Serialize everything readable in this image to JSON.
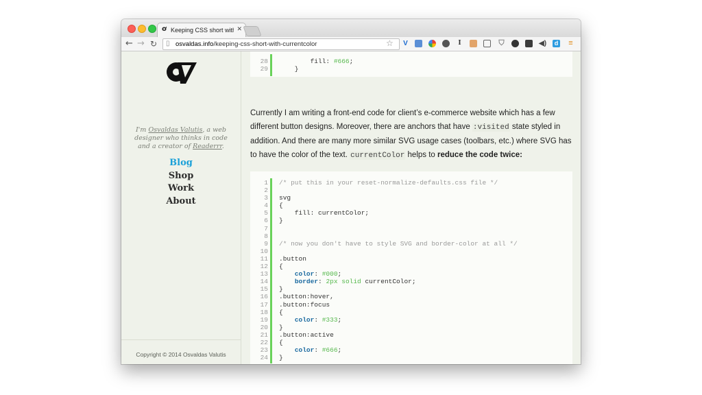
{
  "browser": {
    "tab_title": "Keeping CSS short with cu",
    "tab_favicon": "ov-logo-icon",
    "url_host": "osvaldas.info",
    "url_path": "/keeping-css-short-with-currentcolor",
    "icons": [
      "back-icon",
      "forward-icon",
      "reload-icon",
      "page-icon",
      "star-icon",
      "menu-icon"
    ]
  },
  "sidebar": {
    "bio_prefix": "I'm ",
    "bio_name": "Osvaldas Valutis",
    "bio_middle": ", a web designer who thinks in code and a creator of ",
    "bio_product": "Readerrr",
    "bio_suffix": ".",
    "nav": [
      {
        "label": "Blog",
        "active": true
      },
      {
        "label": "Shop",
        "active": false
      },
      {
        "label": "Work",
        "active": false
      },
      {
        "label": "About",
        "active": false
      }
    ],
    "copyright": "Copyright © 2014 Osvaldas Valutis",
    "accent_color": "#1aa0d8"
  },
  "code_top": {
    "lines": [
      {
        "num": "28",
        "text": "        fill: ",
        "val": "#666",
        "tail": ";"
      },
      {
        "num": "29",
        "text": "    }",
        "val": "",
        "tail": ""
      }
    ]
  },
  "prose": {
    "p1": "Currently I am writing a front-end code for client’s e-commerce website which has a few different button designs. Moreover, there are anchors that have ",
    "code1": ":visited",
    "p2": " state styled in addition. And there are many more similar SVG usage cases (toolbars, etc.) where SVG has to have the color of the text. ",
    "code2": "currentColor",
    "p3": " helps to ",
    "bold": "reduce the code twice:"
  },
  "code_main": {
    "lines": [
      {
        "num": "1",
        "parts": [
          {
            "t": "comment",
            "s": "/* put this in your reset-normalize-defaults.css file */"
          }
        ]
      },
      {
        "num": "2",
        "parts": []
      },
      {
        "num": "3",
        "parts": [
          {
            "t": "plain",
            "s": "svg"
          }
        ]
      },
      {
        "num": "4",
        "parts": [
          {
            "t": "plain",
            "s": "{"
          }
        ]
      },
      {
        "num": "5",
        "parts": [
          {
            "t": "plain",
            "s": "    fill: currentColor;"
          }
        ]
      },
      {
        "num": "6",
        "parts": [
          {
            "t": "plain",
            "s": "}"
          }
        ]
      },
      {
        "num": "7",
        "parts": []
      },
      {
        "num": "8",
        "parts": []
      },
      {
        "num": "9",
        "parts": [
          {
            "t": "comment",
            "s": "/* now you don't have to style SVG and border-color at all */"
          }
        ]
      },
      {
        "num": "10",
        "parts": []
      },
      {
        "num": "11",
        "parts": [
          {
            "t": "plain",
            "s": ".button"
          }
        ]
      },
      {
        "num": "12",
        "parts": [
          {
            "t": "plain",
            "s": "{"
          }
        ]
      },
      {
        "num": "13",
        "parts": [
          {
            "t": "plain",
            "s": "    "
          },
          {
            "t": "prop",
            "s": "color"
          },
          {
            "t": "plain",
            "s": ": "
          },
          {
            "t": "val",
            "s": "#000"
          },
          {
            "t": "plain",
            "s": ";"
          }
        ]
      },
      {
        "num": "14",
        "parts": [
          {
            "t": "plain",
            "s": "    "
          },
          {
            "t": "prop",
            "s": "border"
          },
          {
            "t": "plain",
            "s": ": "
          },
          {
            "t": "val",
            "s": "2px solid"
          },
          {
            "t": "plain",
            "s": " currentColor;"
          }
        ]
      },
      {
        "num": "15",
        "parts": [
          {
            "t": "plain",
            "s": "}"
          }
        ]
      },
      {
        "num": "16",
        "parts": [
          {
            "t": "plain",
            "s": ".button:hover,"
          }
        ]
      },
      {
        "num": "17",
        "parts": [
          {
            "t": "plain",
            "s": ".button:focus"
          }
        ]
      },
      {
        "num": "18",
        "parts": [
          {
            "t": "plain",
            "s": "{"
          }
        ]
      },
      {
        "num": "19",
        "parts": [
          {
            "t": "plain",
            "s": "    "
          },
          {
            "t": "prop",
            "s": "color"
          },
          {
            "t": "plain",
            "s": ": "
          },
          {
            "t": "val",
            "s": "#333"
          },
          {
            "t": "plain",
            "s": ";"
          }
        ]
      },
      {
        "num": "20",
        "parts": [
          {
            "t": "plain",
            "s": "}"
          }
        ]
      },
      {
        "num": "21",
        "parts": [
          {
            "t": "plain",
            "s": ".button:active"
          }
        ]
      },
      {
        "num": "22",
        "parts": [
          {
            "t": "plain",
            "s": "{"
          }
        ]
      },
      {
        "num": "23",
        "parts": [
          {
            "t": "plain",
            "s": "    "
          },
          {
            "t": "prop",
            "s": "color"
          },
          {
            "t": "plain",
            "s": ": "
          },
          {
            "t": "val",
            "s": "#666"
          },
          {
            "t": "plain",
            "s": ";"
          }
        ]
      },
      {
        "num": "24",
        "parts": [
          {
            "t": "plain",
            "s": "}"
          }
        ]
      }
    ]
  }
}
